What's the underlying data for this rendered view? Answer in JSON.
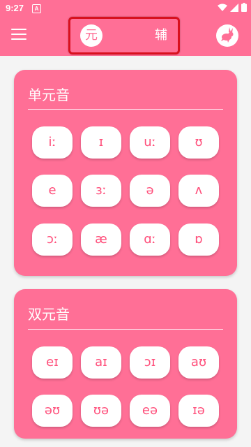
{
  "status_bar": {
    "time": "9:27",
    "notification_icon": "a-icon",
    "right_icons": [
      "wifi-icon",
      "signal-icon",
      "battery-icon"
    ]
  },
  "app_bar": {
    "menu_icon": "hamburger-menu-icon",
    "toggle_left_label": "元",
    "toggle_right_label": "辅",
    "rabbit_icon": "rabbit-icon",
    "accent_color": "#ff6f96"
  },
  "monophthongs": {
    "title": "单元音",
    "keys": [
      "iː",
      "ɪ",
      "uː",
      "ʊ",
      "e",
      "ɜː",
      "ə",
      "ʌ",
      "ɔː",
      "æ",
      "ɑː",
      "ɒ"
    ]
  },
  "diphthongs": {
    "title": "双元音",
    "keys": [
      "eɪ",
      "aɪ",
      "ɔɪ",
      "aʊ",
      "əʊ",
      "ʊə",
      "eə",
      "ɪə"
    ]
  }
}
